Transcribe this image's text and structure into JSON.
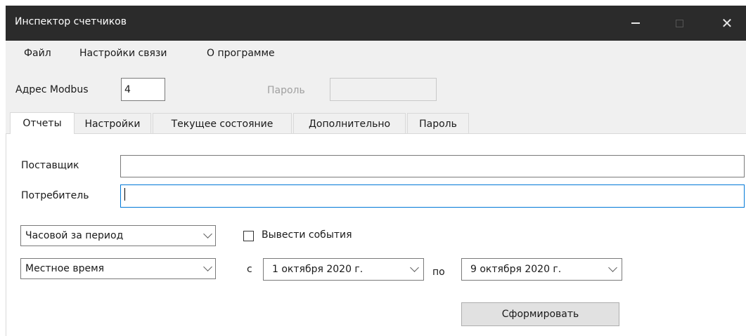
{
  "window": {
    "title": "Инспектор счетчиков"
  },
  "menu": {
    "items": [
      {
        "label": "Файл"
      },
      {
        "label": "Настройки связи"
      },
      {
        "label": "О программе"
      }
    ]
  },
  "connection": {
    "modbus_label": "Адрес Modbus",
    "modbus_value": "4",
    "password_label": "Пароль",
    "password_value": ""
  },
  "tabs": [
    {
      "label": "Отчеты",
      "active": true
    },
    {
      "label": "Настройки",
      "active": false
    },
    {
      "label": "Текущее состояние",
      "active": false
    },
    {
      "label": "Дополнительно",
      "active": false
    },
    {
      "label": "Пароль",
      "active": false
    }
  ],
  "reports": {
    "supplier_label": "Поставщик",
    "supplier_value": "",
    "consumer_label": "Потребитель",
    "consumer_value": "",
    "report_type": "Часовой за период",
    "show_events_label": "Вывести события",
    "show_events_checked": false,
    "time_mode": "Местное время",
    "from_label": "с",
    "from_date": "1  октября  2020 г.",
    "to_label": "по",
    "to_date": "9  октября  2020 г.",
    "generate_label": "Сформировать"
  }
}
